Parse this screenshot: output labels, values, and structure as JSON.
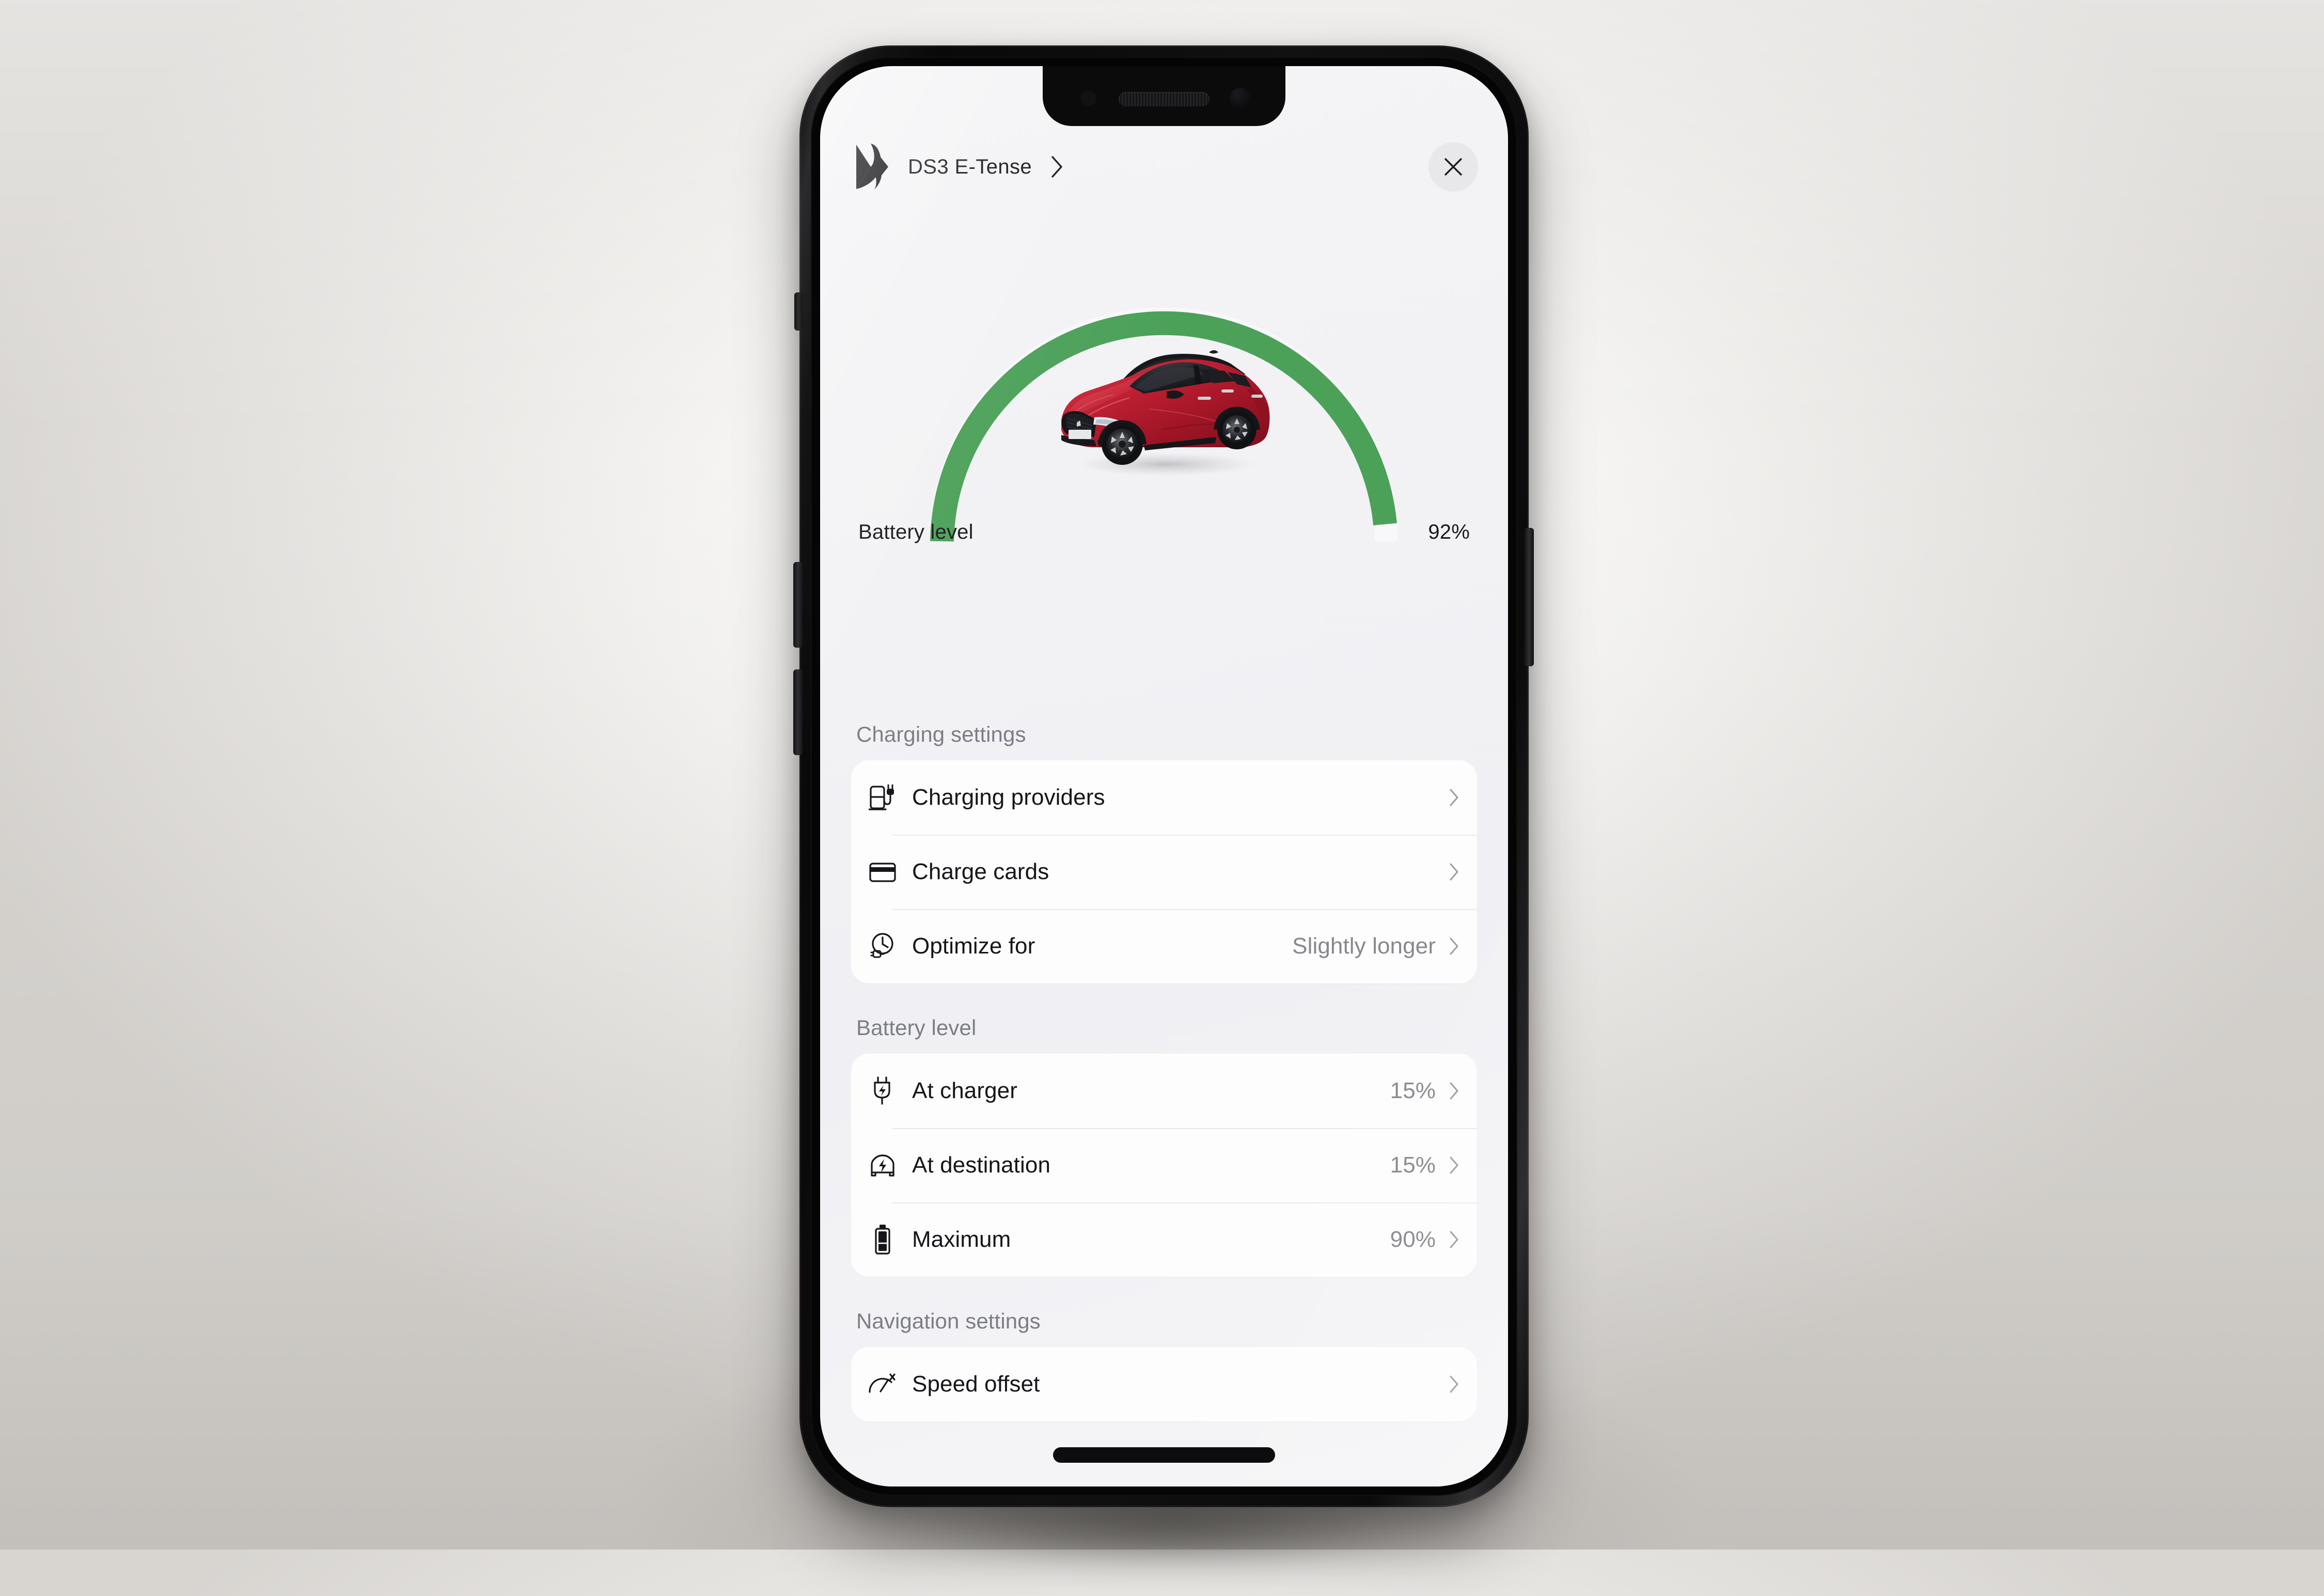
{
  "device": {
    "name": "iphone-mockup",
    "buttons": [
      "silent-switch",
      "volume-up",
      "volume-down",
      "power"
    ]
  },
  "header": {
    "brand_logo": "ds-automobiles-logo",
    "model": "DS3 E-Tense",
    "disclosure_icon": "chevron-right-icon",
    "close_icon": "close-icon",
    "close_label": "Close"
  },
  "gauge": {
    "label": "Battery level",
    "value_text": "92%",
    "percent": 92,
    "arc_color": "#4CA159",
    "track_color": "#f7f7f9",
    "vehicle_image": "ds3-crossback-red-car"
  },
  "sections": [
    {
      "title": "Charging settings",
      "rows": [
        {
          "icon": "charging-station-icon",
          "label": "Charging providers",
          "value": "",
          "chevron": "chevron-right-icon"
        },
        {
          "icon": "credit-card-icon",
          "label": "Charge cards",
          "value": "",
          "chevron": "chevron-right-icon"
        },
        {
          "icon": "clock-plug-icon",
          "label": "Optimize for",
          "value": "Slightly longer",
          "chevron": "chevron-right-icon"
        }
      ]
    },
    {
      "title": "Battery level",
      "rows": [
        {
          "icon": "plug-bolt-icon",
          "label": "At charger",
          "value": "15%",
          "chevron": "chevron-right-icon"
        },
        {
          "icon": "car-bolt-icon",
          "label": "At destination",
          "value": "15%",
          "chevron": "chevron-right-icon"
        },
        {
          "icon": "battery-icon",
          "label": "Maximum",
          "value": "90%",
          "chevron": "chevron-right-icon"
        }
      ]
    },
    {
      "title": "Navigation settings",
      "rows": [
        {
          "icon": "speedometer-icon",
          "label": "Speed offset",
          "value": "",
          "chevron": "chevron-right-icon"
        }
      ]
    }
  ],
  "system": {
    "home_indicator": "home-indicator"
  },
  "colors": {
    "accent_green": "#4CA159",
    "text_primary": "#16161a",
    "text_secondary": "#86888d",
    "section_header": "#7b7e84",
    "card_bg": "#fdfdfd",
    "screen_bg": "#f2f2f5"
  }
}
